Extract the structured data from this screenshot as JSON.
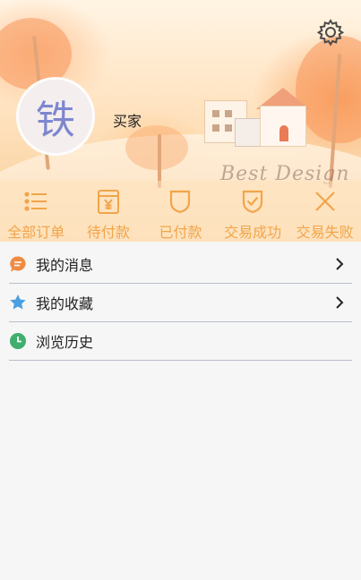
{
  "profile": {
    "avatar_text": "铁",
    "username": "买家"
  },
  "banner": {
    "signature": "Best Design"
  },
  "orders": [
    {
      "label": "全部订单",
      "icon": "list-icon"
    },
    {
      "label": "待付款",
      "icon": "yen-wallet-icon"
    },
    {
      "label": "已付款",
      "icon": "shield-icon"
    },
    {
      "label": "交易成功",
      "icon": "shield-check-icon"
    },
    {
      "label": "交易失败",
      "icon": "close-icon"
    }
  ],
  "menu": [
    {
      "label": "我的消息",
      "icon": "message-icon",
      "chevron": true
    },
    {
      "label": "我的收藏",
      "icon": "star-icon",
      "chevron": true
    },
    {
      "label": "浏览历史",
      "icon": "clock-icon",
      "chevron": false
    }
  ],
  "colors": {
    "accent": "#f1a54a",
    "message": "#ef8c42",
    "star": "#4a9fe1",
    "clock": "#3fae6e",
    "avatar_text": "#7d86cf"
  }
}
